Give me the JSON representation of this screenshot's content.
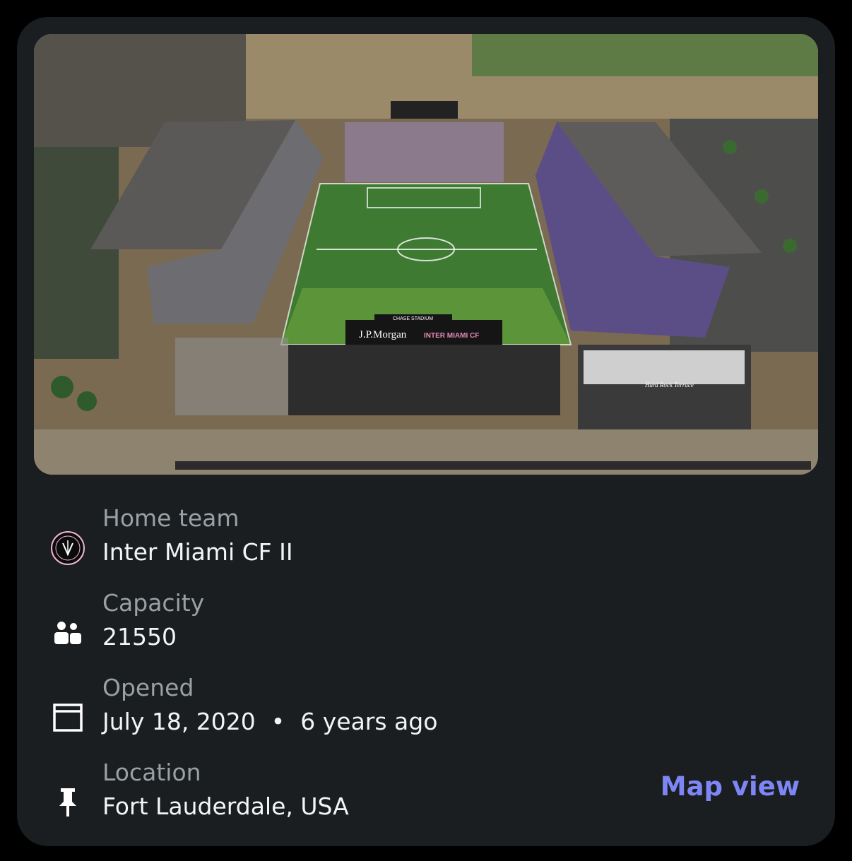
{
  "stadium": {
    "image_alt": "Aerial view of stadium",
    "photo_texts": {
      "board_brand": "J.P.Morgan",
      "board_team": "INTER MIAMI CF",
      "board_stadium": "CHASE STADIUM",
      "terrace": "Hard Rock Terrace"
    }
  },
  "details": [
    {
      "icon": "team-crest-icon",
      "label": "Home team",
      "value": "Inter Miami CF II"
    },
    {
      "icon": "people-icon",
      "label": "Capacity",
      "value": "21550"
    },
    {
      "icon": "calendar-icon",
      "label": "Opened",
      "value": "July 18, 2020",
      "separator": "•",
      "relative": "6 years ago"
    },
    {
      "icon": "pin-icon",
      "label": "Location",
      "value": "Fort Lauderdale, USA"
    }
  ],
  "actions": {
    "map_view": "Map view"
  },
  "colors": {
    "background": "#000000",
    "card": "#1a1e20",
    "label": "#9aa0a3",
    "value": "#f3f4f5",
    "accent": "#7e86f5"
  }
}
